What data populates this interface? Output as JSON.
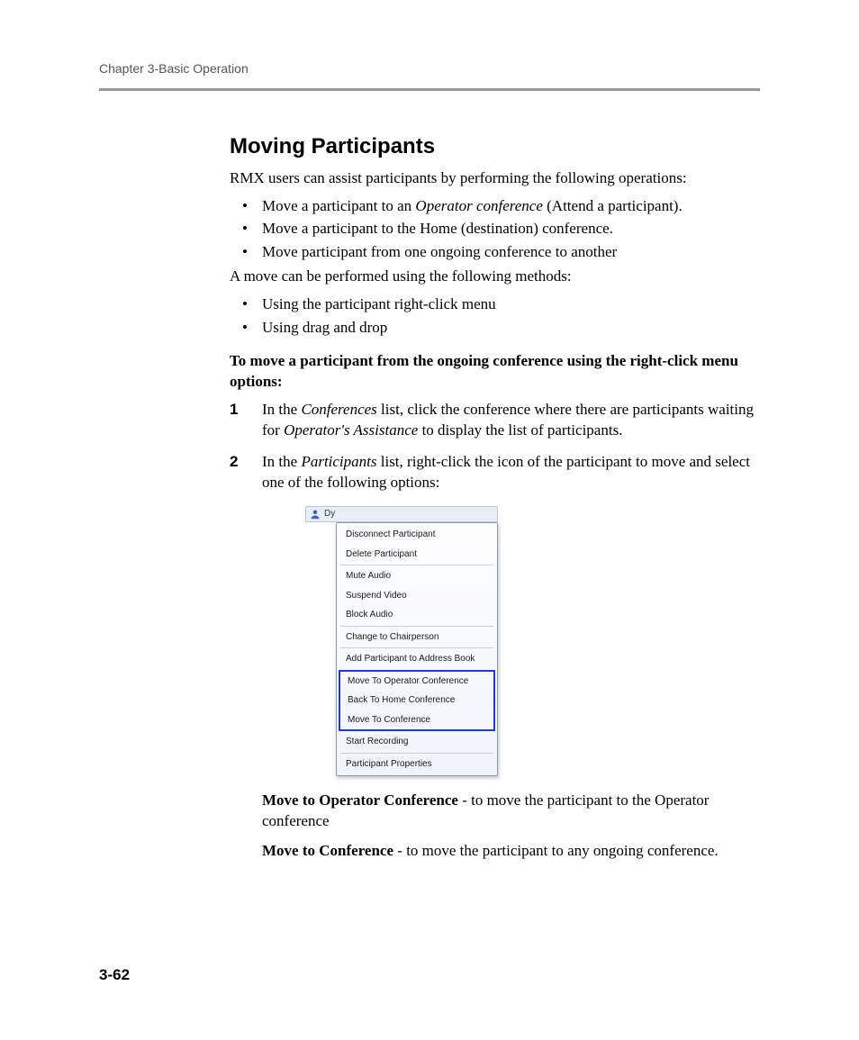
{
  "header": {
    "chapter": "Chapter 3-Basic Operation"
  },
  "section": {
    "title": "Moving Participants",
    "intro": "RMX users can assist participants by performing the following operations:",
    "bullets1_a_pre": "Move a participant to an ",
    "bullets1_a_em": "Operator conference",
    "bullets1_a_post": " (Attend a participant).",
    "bullets1_b": "Move a participant to the Home (destination) conference.",
    "bullets1_c": "Move participant from one ongoing conference to another",
    "methods_intro": "A move can be performed using the following methods:",
    "bullets2_a": "Using the participant right-click menu",
    "bullets2_b": "Using drag and drop",
    "bold_instr": "To move a participant from the ongoing conference using the right-click menu options:",
    "step1_num": "1",
    "step1_a": "In the ",
    "step1_em1": "Conferences",
    "step1_b": " list, click the conference where there are participants waiting for ",
    "step1_em2": "Operator's Assistance",
    "step1_c": " to display the list of participants.",
    "step2_num": "2",
    "step2_a": "In the ",
    "step2_em1": "Participants",
    "step2_b": " list, right-click the icon of the participant to move and select one of the following options:",
    "desc1_strong": "Move to Operator Conference",
    "desc1_rest": " - to move the participant to the Operator conference",
    "desc2_strong": "Move to Conference",
    "desc2_rest": " - to move the participant to any ongoing conference."
  },
  "menu": {
    "row_label": "Dy",
    "items_top": [
      "Disconnect Participant",
      "Delete Participant",
      "Mute Audio",
      "Suspend Video",
      "Block Audio",
      "Change to Chairperson",
      "Add Participant to Address Book"
    ],
    "items_highlight": [
      "Move To Operator Conference",
      "Back To Home Conference",
      "Move To Conference"
    ],
    "items_bottom": [
      "Start Recording",
      "Participant Properties"
    ]
  },
  "footer": {
    "page": "3-62"
  }
}
